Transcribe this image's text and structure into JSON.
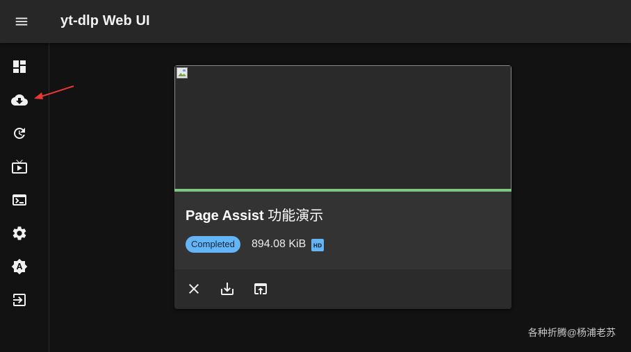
{
  "app": {
    "title": "yt-dlp Web UI"
  },
  "colors": {
    "progress": "#81c784",
    "chip": "#64b5f6",
    "annotation_arrow": "#e53935"
  },
  "sidebar": {
    "items": [
      {
        "icon": "dashboard-icon"
      },
      {
        "icon": "cloud-download-icon"
      },
      {
        "icon": "history-icon"
      },
      {
        "icon": "live-tv-icon"
      },
      {
        "icon": "terminal-icon"
      },
      {
        "icon": "settings-gear-icon"
      },
      {
        "icon": "brightness-auto-icon"
      },
      {
        "icon": "logout-icon"
      }
    ]
  },
  "download": {
    "title_latin": "Page Assist",
    "title_cjk": " 功能演示",
    "status": "Completed",
    "size": "894.08 KiB",
    "quality_badge": "HD",
    "progress_percent": 100,
    "actions": [
      "close-icon",
      "download-icon",
      "open-external-icon"
    ]
  },
  "watermark": "各种折腾@杨浦老苏"
}
